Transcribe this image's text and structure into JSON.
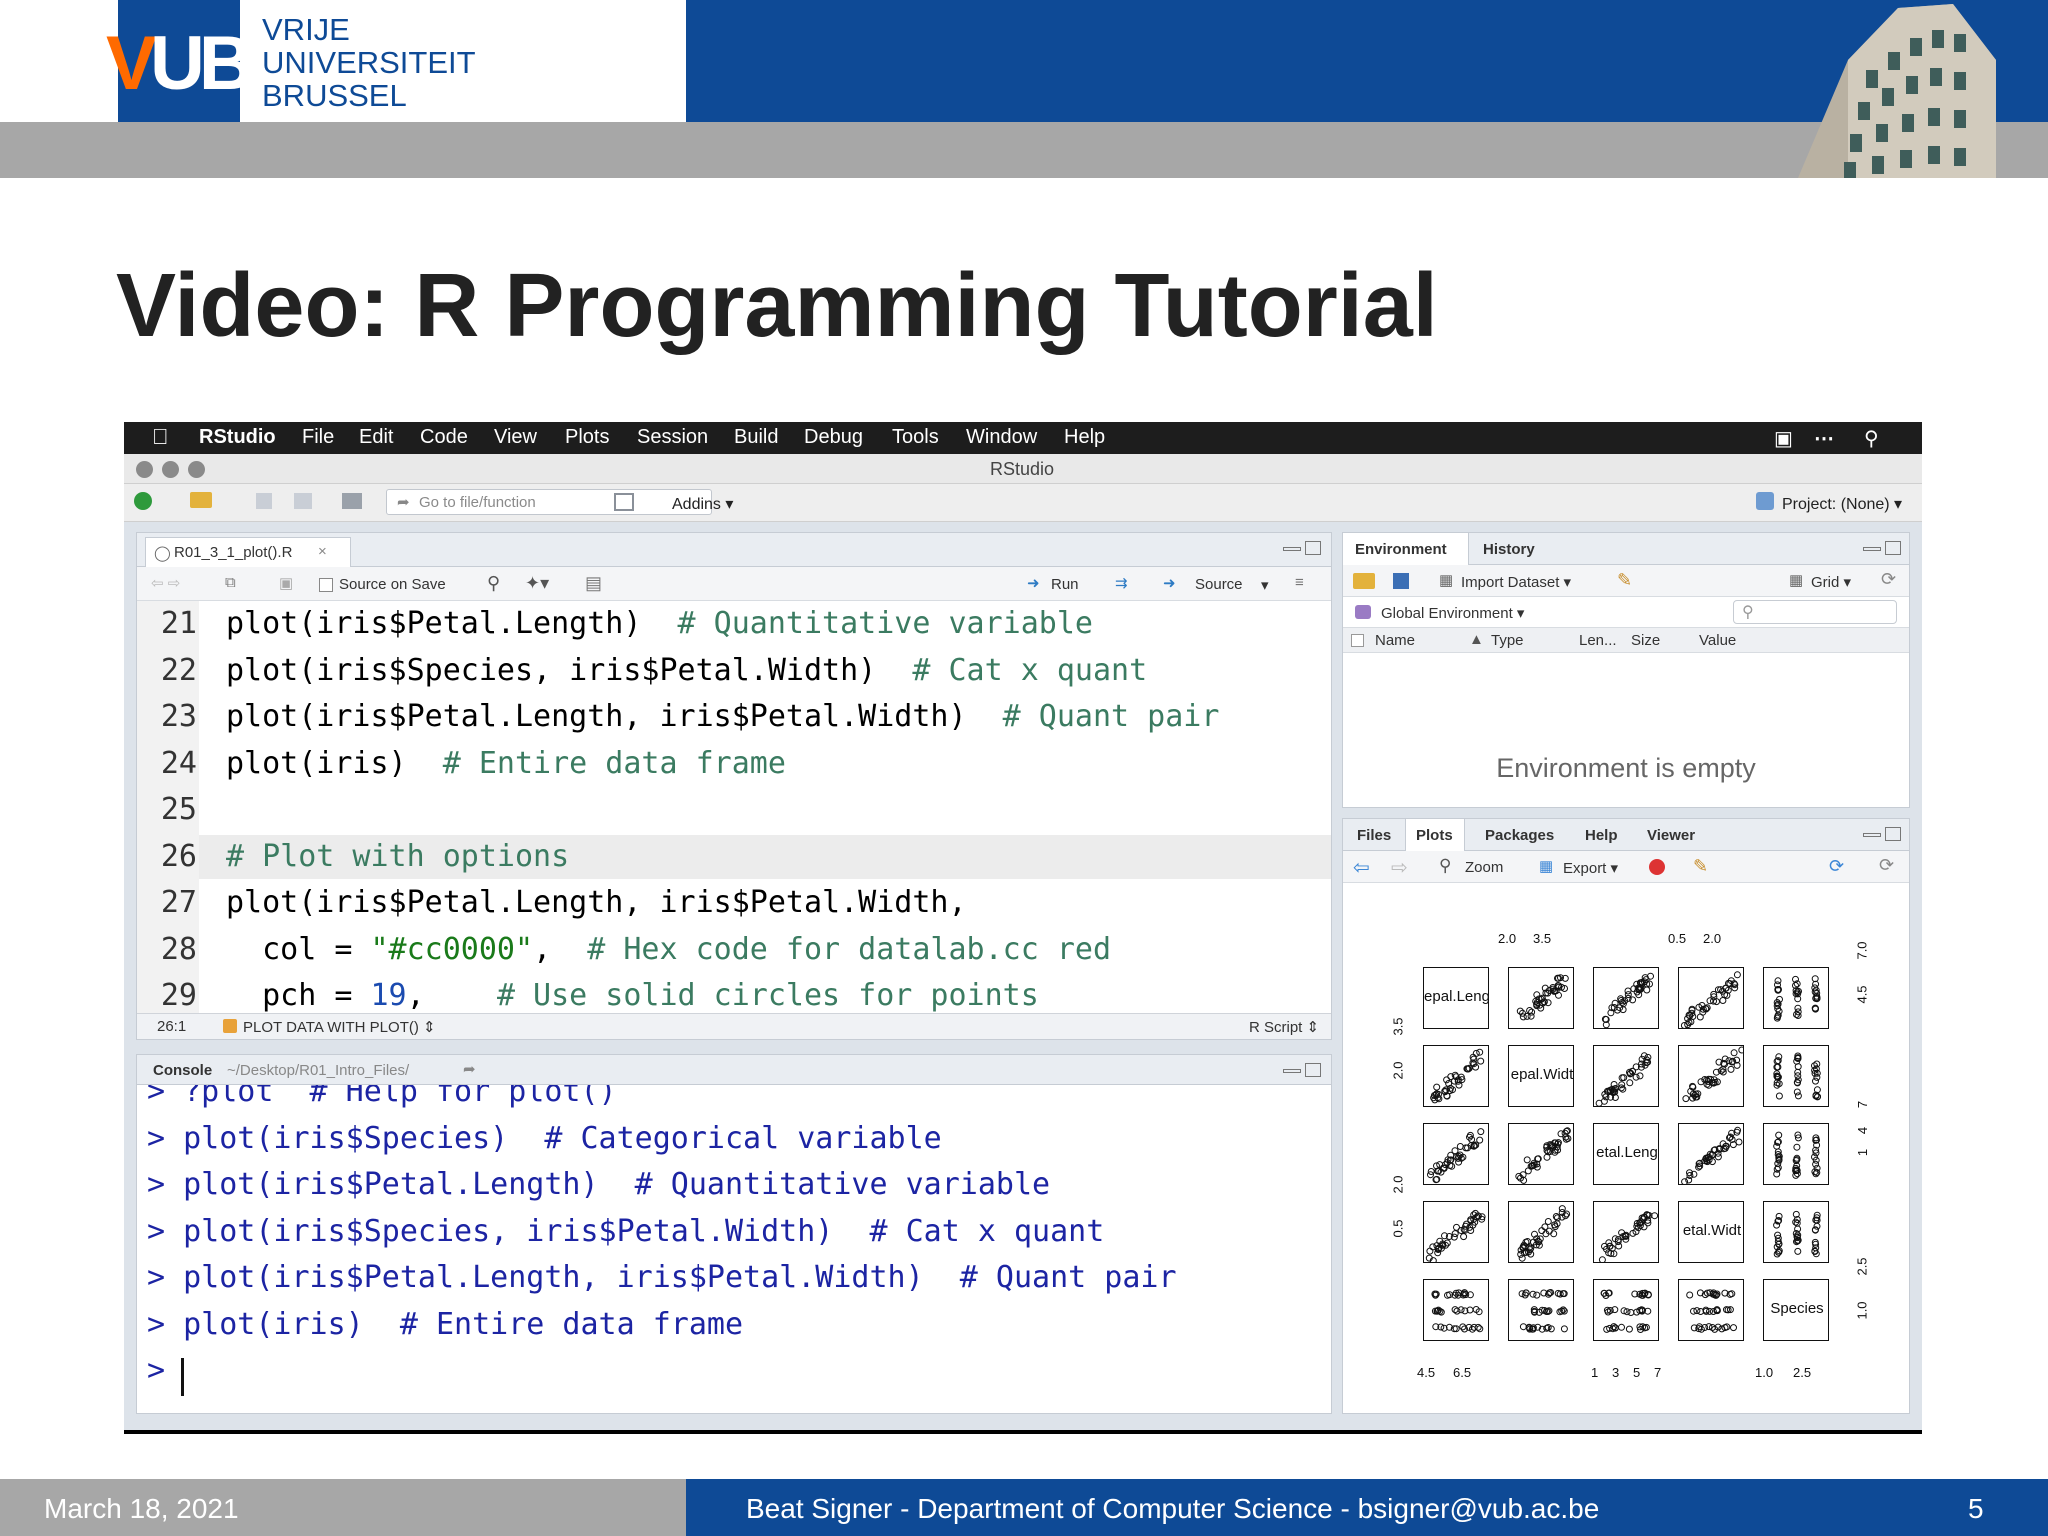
{
  "slide": {
    "logo_text": "VUB",
    "university_lines": [
      "VRIJE",
      "UNIVERSITEIT",
      "BRUSSEL"
    ],
    "title": "Video: R Programming Tutorial",
    "footer_date": "March 18, 2021",
    "footer_author": "Beat Signer - Department of Computer Science - bsigner@vub.ac.be",
    "footer_page": "5",
    "colors": {
      "brand_blue": "#0e4a96",
      "grey_band": "#a7a7a7",
      "vub_orange": "#ff6a00"
    }
  },
  "menubar": {
    "app": "RStudio",
    "items": [
      "File",
      "Edit",
      "Code",
      "View",
      "Plots",
      "Session",
      "Build",
      "Debug",
      "Tools",
      "Window",
      "Help"
    ]
  },
  "window": {
    "title": "RStudio"
  },
  "toolbar": {
    "goto_placeholder": "Go to file/function",
    "addins": "Addins",
    "project": "Project: (None)"
  },
  "editor": {
    "tab": "R01_3_1_plot().R",
    "source_on_save": "Source on Save",
    "run": "Run",
    "source": "Source",
    "line_numbers": [
      "21",
      "22",
      "23",
      "24",
      "25",
      "26",
      "27",
      "28",
      "29"
    ],
    "lines": [
      {
        "code": "plot(iris$Petal.Length)",
        "comment": "# Quantitative variable"
      },
      {
        "code": "plot(iris$Species, iris$Petal.Width)",
        "comment": "# Cat x quant"
      },
      {
        "code": "plot(iris$Petal.Length, iris$Petal.Width)",
        "comment": "# Quant pair"
      },
      {
        "code": "plot(iris)",
        "comment": "# Entire data frame"
      },
      {
        "code": "",
        "comment": ""
      },
      {
        "code": "",
        "comment": "# Plot with options"
      },
      {
        "code": "plot(iris$Petal.Length, iris$Petal.Width,",
        "comment": ""
      },
      {
        "code": "  col = ",
        "string": "\"#cc0000\"",
        "code_after": ",",
        "comment": "# Hex code for datalab.cc red"
      },
      {
        "code": "  pch = ",
        "number": "19",
        "code_after": ",",
        "comment": "# Use solid circles for points"
      }
    ],
    "status_pos": "26:1",
    "status_section": "PLOT DATA WITH PLOT()",
    "status_type": "R Script"
  },
  "console": {
    "title": "Console",
    "path": "~/Desktop/R01_Intro_Files/",
    "lines": [
      "> ?plot  # Help for plot()",
      "> plot(iris$Species)  # Categorical variable",
      "> plot(iris$Petal.Length)  # Quantitative variable",
      "> plot(iris$Species, iris$Petal.Width)  # Cat x quant",
      "> plot(iris$Petal.Length, iris$Petal.Width)  # Quant pair",
      "> plot(iris)  # Entire data frame",
      ">"
    ]
  },
  "environment": {
    "tabs": [
      "Environment",
      "History"
    ],
    "import_dataset": "Import Dataset",
    "grid": "Grid",
    "scope": "Global Environment",
    "columns": [
      "Name",
      "Type",
      "Len...",
      "Size",
      "Value"
    ],
    "empty_message": "Environment is empty"
  },
  "plots_pane": {
    "tabs": [
      "Files",
      "Plots",
      "Packages",
      "Help",
      "Viewer"
    ],
    "zoom": "Zoom",
    "export": "Export",
    "diag_labels": [
      "epal.Leng",
      "epal.Widt",
      "etal.Leng",
      "etal.Widt",
      "Species"
    ],
    "top_ticks": [
      [
        "2.0",
        "3.5"
      ],
      [
        "0.5",
        "2.0"
      ]
    ],
    "bottom_ticks": [
      [
        "4.5",
        "6.5"
      ],
      [
        "1",
        "3",
        "5",
        "7"
      ],
      [
        "1.0",
        "2.5"
      ]
    ],
    "left_ticks": [
      [
        "2.0",
        "3.5"
      ],
      [
        "0.5",
        "2.0"
      ]
    ],
    "right_ticks": [
      [
        "4.5",
        "7.0"
      ],
      [
        "1",
        "4",
        "7"
      ],
      [
        "1.0",
        "2.5"
      ]
    ]
  }
}
